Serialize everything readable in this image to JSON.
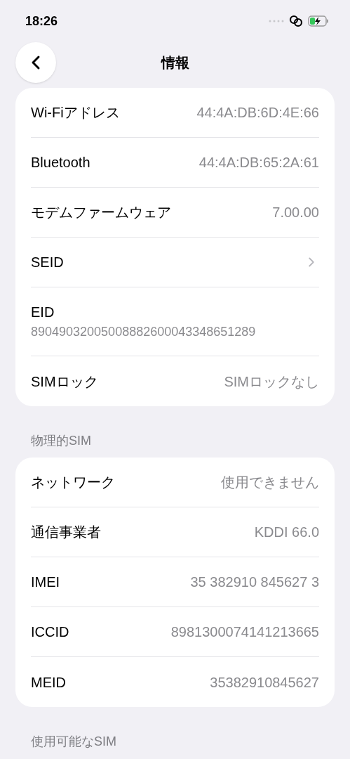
{
  "status_bar": {
    "time": "18:26"
  },
  "nav": {
    "title": "情報"
  },
  "sections": [
    {
      "rows": [
        {
          "kind": "value",
          "label": "Wi-Fiアドレス",
          "value": "44:4A:DB:6D:4E:66"
        },
        {
          "kind": "value",
          "label": "Bluetooth",
          "value": "44:4A:DB:65:2A:61"
        },
        {
          "kind": "value",
          "label": "モデムファームウェア",
          "value": "7.00.00"
        },
        {
          "kind": "link",
          "label": "SEID"
        },
        {
          "kind": "stacked",
          "label": "EID",
          "value": "89049032005008882600043348651289"
        },
        {
          "kind": "value",
          "label": "SIMロック",
          "value": "SIMロックなし"
        }
      ]
    },
    {
      "header": "物理的SIM",
      "rows": [
        {
          "kind": "value",
          "label": "ネットワーク",
          "value": "使用できません"
        },
        {
          "kind": "value",
          "label": "通信事業者",
          "value": "KDDI 66.0"
        },
        {
          "kind": "value",
          "label": "IMEI",
          "value": "35 382910 845627 3"
        },
        {
          "kind": "value",
          "label": "ICCID",
          "value": "8981300074141213665"
        },
        {
          "kind": "value",
          "label": "MEID",
          "value": "35382910845627"
        }
      ]
    },
    {
      "header": "使用可能なSIM"
    }
  ]
}
